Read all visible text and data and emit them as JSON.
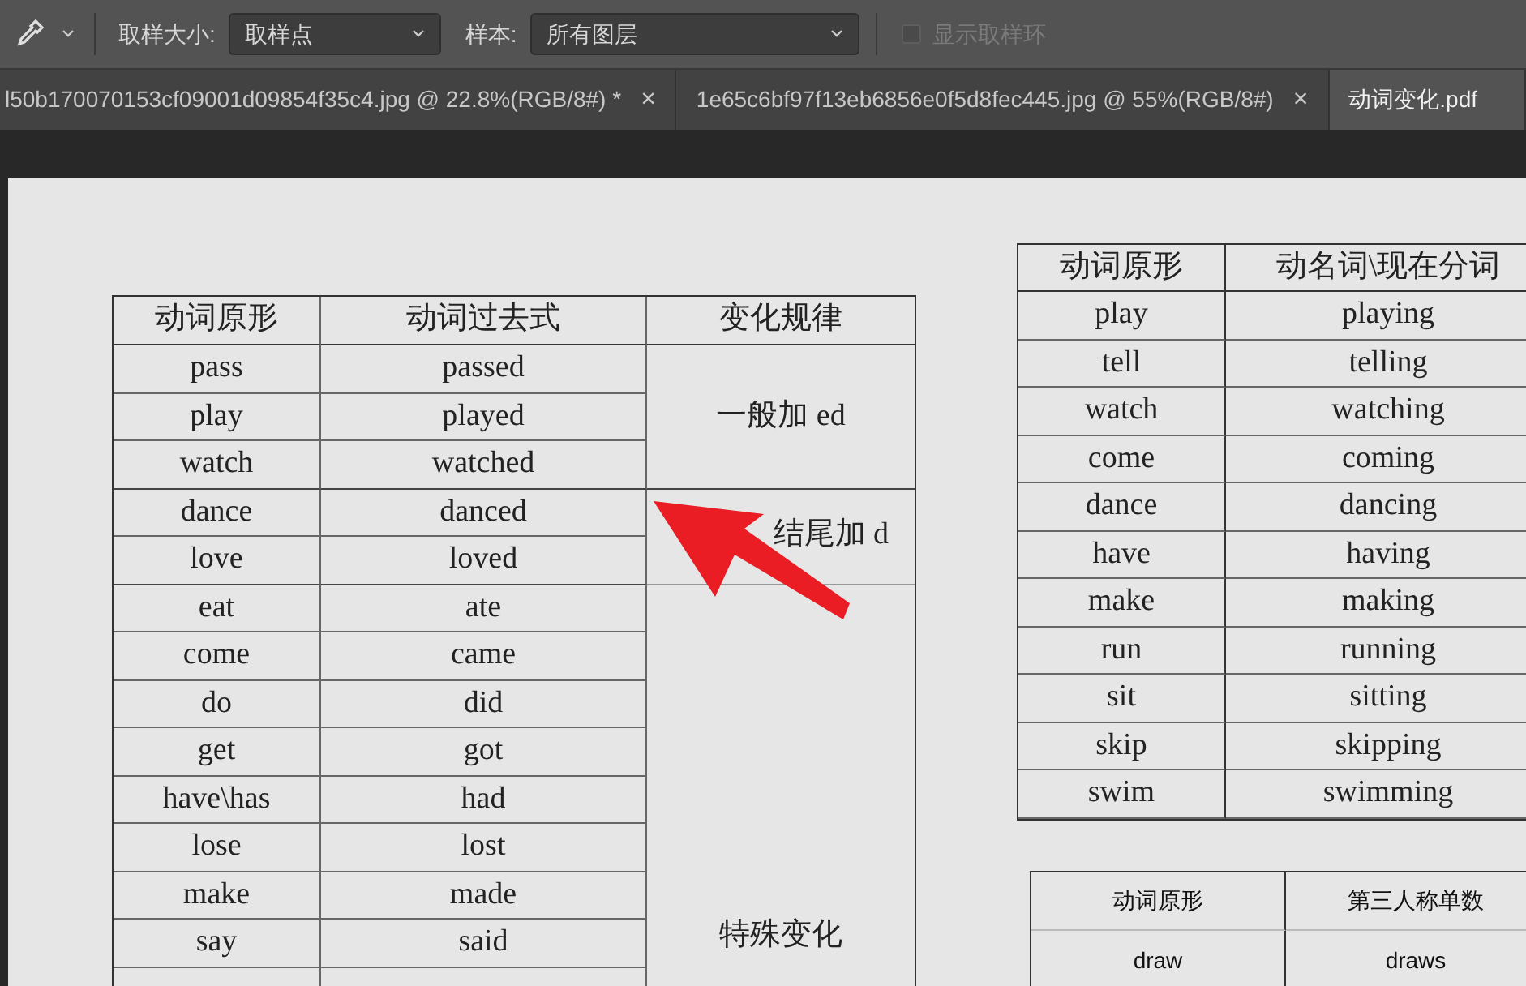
{
  "options_bar": {
    "sample_size_label": "取样大小:",
    "sample_size_value": "取样点",
    "sample_label": "样本:",
    "sample_value": "所有图层",
    "show_ring": {
      "label": "显示取样环",
      "checked": false,
      "disabled": true
    }
  },
  "tabs": [
    {
      "label": "l50b170070153cf09001d09854f35c4.jpg @ 22.8%(RGB/8#) *",
      "close": "×",
      "selected": false
    },
    {
      "label": "1e65c6bf97f13eb6856e0f5d8fec445.jpg @ 55%(RGB/8#)",
      "close": "×",
      "selected": false
    },
    {
      "label": "动词变化.pdf",
      "selected": true
    }
  ],
  "past_table": {
    "columns": [
      "动词原形",
      "动词过去式",
      "变化规律"
    ],
    "groups": [
      {
        "rule": "一般加 ed",
        "rows": [
          [
            "pass",
            "passed"
          ],
          [
            "play",
            "played"
          ],
          [
            "watch",
            "watched"
          ]
        ]
      },
      {
        "rule": "结尾加 d",
        "rows": [
          [
            "dance",
            "danced"
          ],
          [
            "love",
            "loved"
          ]
        ]
      },
      {
        "rule": "特殊变化",
        "rows": [
          [
            "eat",
            "ate"
          ],
          [
            "come",
            "came"
          ],
          [
            "do",
            "did"
          ],
          [
            "get",
            "got"
          ],
          [
            "have\\has",
            "had"
          ],
          [
            "lose",
            "lost"
          ],
          [
            "make",
            "made"
          ],
          [
            "say",
            "said"
          ]
        ]
      }
    ]
  },
  "ing_table": {
    "columns": [
      "动词原形",
      "动名词\\现在分词"
    ],
    "rows": [
      [
        "play",
        "playing"
      ],
      [
        "tell",
        "telling"
      ],
      [
        "watch",
        "watching"
      ],
      [
        "come",
        "coming"
      ],
      [
        "dance",
        "dancing"
      ],
      [
        "have",
        "having"
      ],
      [
        "make",
        "making"
      ],
      [
        "run",
        "running"
      ],
      [
        "sit",
        "sitting"
      ],
      [
        "skip",
        "skipping"
      ],
      [
        "swim",
        "swimming"
      ]
    ]
  },
  "third_person_table": {
    "columns": [
      "动词原形",
      "第三人称单数"
    ],
    "rows": [
      [
        "draw",
        "draws"
      ]
    ]
  }
}
